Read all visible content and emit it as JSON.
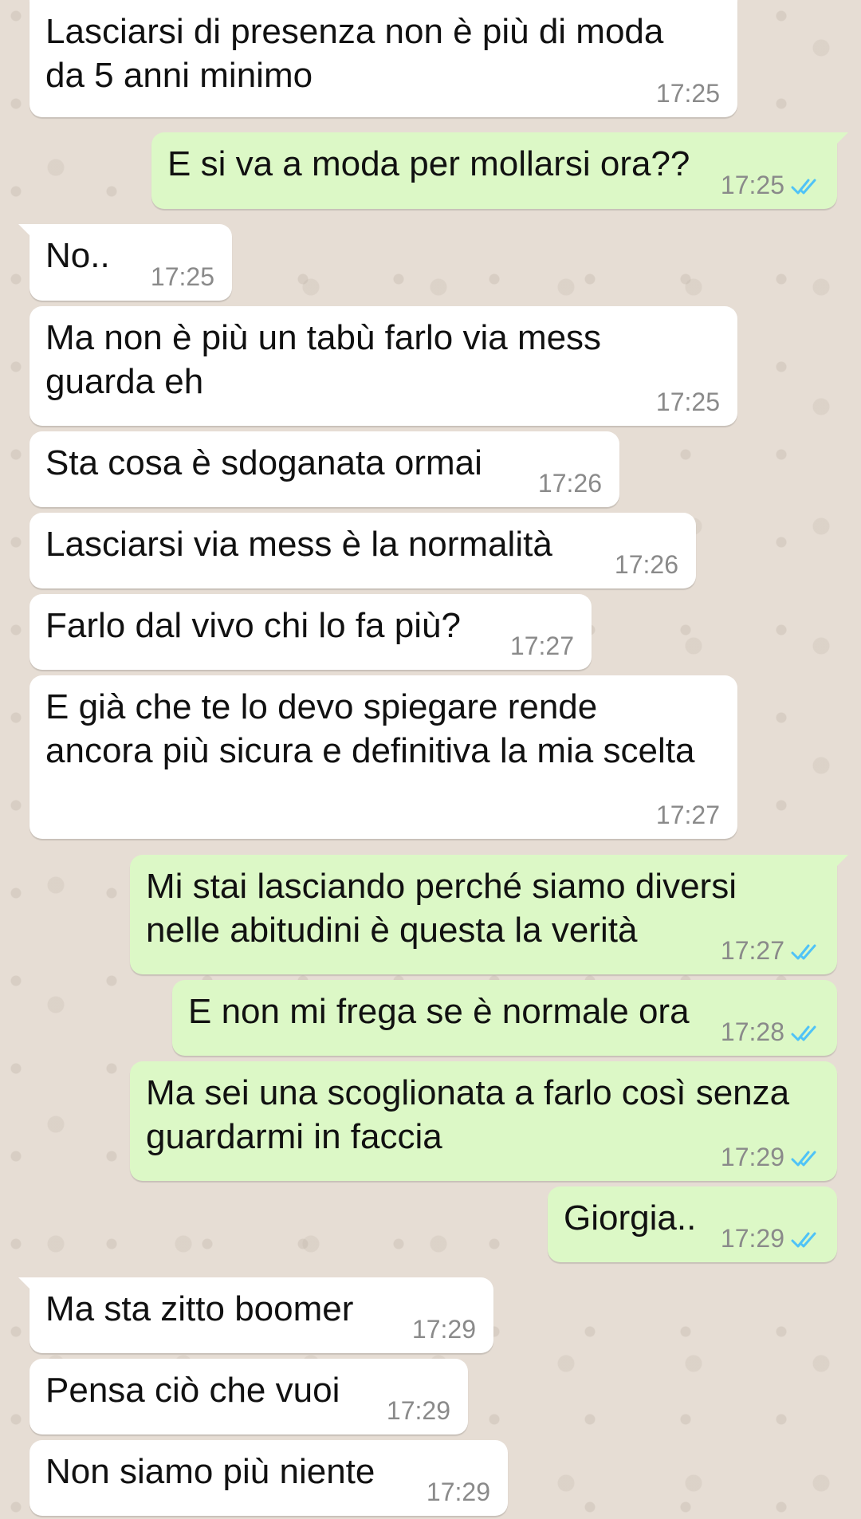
{
  "conversation": {
    "messages": [
      {
        "text": "Lasciarsi di presenza non è più di moda\nda 5 anni minimo",
        "time": "17:25",
        "direction": "in"
      },
      {
        "text": "E si va a moda per mollarsi ora??",
        "time": "17:25",
        "direction": "out",
        "status": "read"
      },
      {
        "text": "No..",
        "time": "17:25",
        "direction": "in"
      },
      {
        "text": "Ma non è più un tabù farlo via mess\nguarda eh",
        "time": "17:25",
        "direction": "in"
      },
      {
        "text": "Sta cosa è sdoganata ormai",
        "time": "17:26",
        "direction": "in"
      },
      {
        "text": "Lasciarsi via mess è la normalità",
        "time": "17:26",
        "direction": "in"
      },
      {
        "text": "Farlo dal vivo chi lo fa più?",
        "time": "17:27",
        "direction": "in"
      },
      {
        "text": "E già che te lo devo spiegare rende\nancora più sicura e definitiva la mia scelta",
        "time": "17:27",
        "direction": "in"
      },
      {
        "text": "Mi stai lasciando perché siamo diversi\nnelle abitudini è questa la verità",
        "time": "17:27",
        "direction": "out",
        "status": "read"
      },
      {
        "text": "E non mi frega se è normale ora",
        "time": "17:28",
        "direction": "out",
        "status": "read"
      },
      {
        "text": "Ma sei una scoglionata a farlo così senza\nguardarmi in faccia",
        "time": "17:29",
        "direction": "out",
        "status": "read"
      },
      {
        "text": "Giorgia..",
        "time": "17:29",
        "direction": "out",
        "status": "read"
      },
      {
        "text": "Ma sta zitto boomer",
        "time": "17:29",
        "direction": "in"
      },
      {
        "text": "Pensa ciò che vuoi",
        "time": "17:29",
        "direction": "in"
      },
      {
        "text": "Non siamo più niente",
        "time": "17:29",
        "direction": "in"
      }
    ]
  },
  "colors": {
    "incoming_bubble": "#ffffff",
    "outgoing_bubble": "#dcf8c6",
    "read_ticks": "#4fc3f7",
    "timestamp": "#8a8a8a",
    "wallpaper": "#e6ddd4"
  },
  "icons": {
    "read_receipt": "double-check-icon"
  }
}
